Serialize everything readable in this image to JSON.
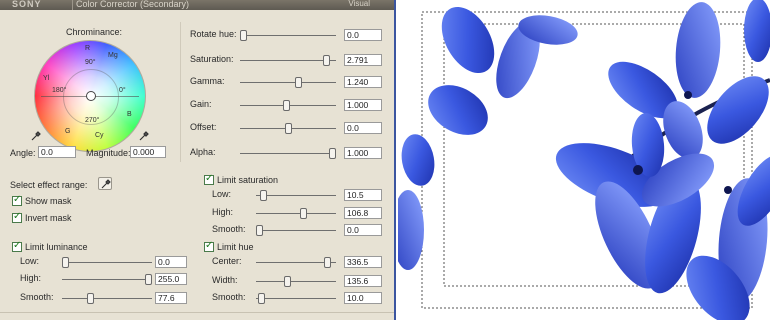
{
  "window": {
    "brand": "SONY",
    "title": "Color Corrector (Secondary)",
    "right_label": "Visual"
  },
  "chrominance": {
    "label": "Chrominance:",
    "wheel_labels": {
      "r": "R",
      "mg": "Mg",
      "yl": "Yl",
      "g": "G",
      "cy": "Cy",
      "b": "B",
      "deg90": "90°",
      "deg180": "180°",
      "deg270": "270°",
      "deg0": "0°"
    },
    "angle_label": "Angle:",
    "angle_value": "0.0",
    "magnitude_label": "Magnitude:",
    "magnitude_value": "0.000"
  },
  "params": [
    {
      "label": "Rotate hue:",
      "value": "0.0",
      "level": 0.0
    },
    {
      "label": "Saturation:",
      "value": "2.791",
      "level": 0.93
    },
    {
      "label": "Gamma:",
      "value": "1.240",
      "level": 0.62
    },
    {
      "label": "Gain:",
      "value": "1.000",
      "level": 0.48
    },
    {
      "label": "Offset:",
      "value": "0.0",
      "level": 0.5
    },
    {
      "label": "Alpha:",
      "value": "1.000",
      "level": 1.0
    }
  ],
  "effect_range": {
    "select_label": "Select effect range:",
    "show_mask": "Show mask",
    "invert_mask": "Invert mask"
  },
  "limit_luminance": {
    "label": "Limit luminance",
    "rows": [
      {
        "label": "Low:",
        "value": "0.0",
        "level": 0.0
      },
      {
        "label": "High:",
        "value": "255.0",
        "level": 1.0
      },
      {
        "label": "Smooth:",
        "value": "77.6",
        "level": 0.3
      }
    ]
  },
  "limit_saturation": {
    "label": "Limit saturation",
    "rows": [
      {
        "label": "Low:",
        "value": "10.5",
        "level": 0.05
      },
      {
        "label": "High:",
        "value": "106.8",
        "level": 0.6
      },
      {
        "label": "Smooth:",
        "value": "0.0",
        "level": 0.0
      }
    ]
  },
  "limit_hue": {
    "label": "Limit hue",
    "rows": [
      {
        "label": "Center:",
        "value": "336.5",
        "level": 0.93
      },
      {
        "label": "Width:",
        "value": "135.6",
        "level": 0.38
      },
      {
        "label": "Smooth:",
        "value": "10.0",
        "level": 0.03
      }
    ]
  },
  "colors": {
    "panel": "#e7e2d4",
    "accent": "#3b55a0",
    "check": "#1f7a1f",
    "flower": "#3a58e0"
  }
}
